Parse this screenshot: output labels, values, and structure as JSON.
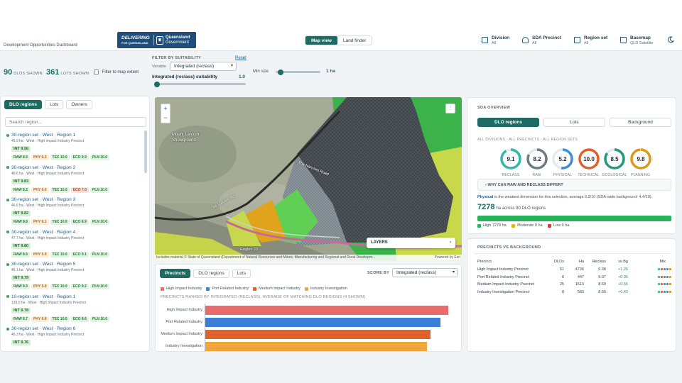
{
  "app": {
    "title": "Development Opportunities Dashboard"
  },
  "logo": {
    "line1a": "DELIVERING",
    "line1b": "FOR QUEENSLAND",
    "line2a": "Queensland",
    "line2b": "Government"
  },
  "view_toggle": {
    "map": "Map view",
    "land": "Land finder"
  },
  "nav": [
    {
      "label": "Division",
      "value": "All"
    },
    {
      "label": "SDA Precinct",
      "value": "All"
    },
    {
      "label": "Region set",
      "value": "All"
    },
    {
      "label": "Basemap",
      "value": "QLD Satellite"
    }
  ],
  "stats": {
    "dlos": "90",
    "dlos_label": "DLOS SHOWN",
    "lots": "361",
    "lots_label": "LOTS SHOWN",
    "filter_label": "Filter to map extent"
  },
  "filter": {
    "heading": "FILTER BY SUITABILITY",
    "reset": "Reset",
    "variable_label": "Variable",
    "variable_value": "Integrated (reclass)",
    "slider_label": "Integrated (reclass) suitability",
    "slider_value": "1.0",
    "minsize_label": "Min size",
    "minsize_value": "1 ha",
    "minsize_fraction": 0.05,
    "suitability_fraction": 0.0
  },
  "left": {
    "tabs": [
      "DLO regions",
      "Lots",
      "Owners"
    ],
    "search_placeholder": "Search region...",
    "regions": [
      {
        "name": "30-region set · West · Region 1",
        "sub": "45.9 ha · West · High Impact Industry Precinct",
        "int": "INT 9.56",
        "chips": [
          [
            "RAW 8.5",
            "g"
          ],
          [
            "PHY 6.3",
            "o"
          ],
          [
            "TEC 10.0",
            "g"
          ],
          [
            "ECO 9.9",
            "g"
          ],
          [
            "PLN 10.0",
            "g"
          ]
        ]
      },
      {
        "name": "30-region set · West · Region 2",
        "sub": "48.6 ha · West · High Impact Industry Precinct",
        "int": "INT 9.83",
        "chips": [
          [
            "RAW 8.2",
            "g"
          ],
          [
            "PHY 6.0",
            "o"
          ],
          [
            "TEC 10.0",
            "g"
          ],
          [
            "ECO 7.0",
            "r"
          ],
          [
            "PLN 10.0",
            "g"
          ]
        ]
      },
      {
        "name": "30-region set · West · Region 3",
        "sub": "46.6 ha · West · High Impact Industry Precinct",
        "int": "INT 9.82",
        "chips": [
          [
            "RAW 8.6",
            "g"
          ],
          [
            "PHY 6.1",
            "o"
          ],
          [
            "TEC 10.0",
            "g"
          ],
          [
            "ECO 8.9",
            "g"
          ],
          [
            "PLN 10.0",
            "g"
          ]
        ]
      },
      {
        "name": "30-region set · West · Region 4",
        "sub": "47.7 ha · West · High Impact Industry Precinct",
        "int": "INT 9.80",
        "chips": [
          [
            "RAW 8.6",
            "g"
          ],
          [
            "PHY 5.9",
            "o"
          ],
          [
            "TEC 10.0",
            "g"
          ],
          [
            "ECO 9.1",
            "g"
          ],
          [
            "PLN 10.0",
            "g"
          ]
        ]
      },
      {
        "name": "30-region set · West · Region 5",
        "sub": "46.1 ha · West · High Impact Industry Precinct",
        "int": "INT 9.79",
        "chips": [
          [
            "RAW 8.5",
            "g"
          ],
          [
            "PHY 5.9",
            "o"
          ],
          [
            "TEC 10.0",
            "g"
          ],
          [
            "ECO 9.2",
            "g"
          ],
          [
            "PLN 10.0",
            "g"
          ]
        ]
      },
      {
        "name": "10-region set · West · Region 1",
        "sub": "139.0 ha · West · High Impact Industry Precinct",
        "int": "INT 9.78",
        "chips": [
          [
            "RAW 8.7",
            "g"
          ],
          [
            "PHY 6.8",
            "o"
          ],
          [
            "TEC 10.0",
            "g"
          ],
          [
            "ECO 8.6",
            "g"
          ],
          [
            "PLN 10.0",
            "g"
          ]
        ]
      },
      {
        "name": "30-region set · West · Region 6",
        "sub": "46.3 ha · West · High Impact Industry Precinct",
        "int": "INT 9.76",
        "chips": []
      }
    ]
  },
  "map": {
    "labels": [
      "Mount Larcom",
      "Showground",
      "The Narrows Road",
      "Mt Larcom Rd",
      "Bruce Hwy",
      "Region 23"
    ],
    "attribution": "Includes material © State of Queensland (Department of Natural Resources and Mines, Manufacturing and Regional and Rural Developm...",
    "powered": "Powered by Esri",
    "layers": "LAYERS",
    "zoom_in": "+",
    "zoom_out": "−"
  },
  "chart_panel": {
    "tabs": [
      "Precincts",
      "DLO regions",
      "Lots"
    ],
    "score_by_label": "SCORE BY",
    "score_by_value": "Integrated (reclass)",
    "legend": [
      {
        "name": "High Impact Industry",
        "color": "#e96b6b"
      },
      {
        "name": "Port Related Industry",
        "color": "#3a7fd5"
      },
      {
        "name": "Medium Impact Industry",
        "color": "#e0612a"
      },
      {
        "name": "Industry Investigation",
        "color": "#f0a63a"
      }
    ],
    "subtitle": "PRECINCTS RANKED BY INTEGRATED (RECLASS), AVERAGE OF MATCHING DLO REGIONS (4 SHOWN)"
  },
  "chart_data": {
    "type": "bar",
    "orientation": "horizontal",
    "categories": [
      "High Impact Industry",
      "Port Related Industry",
      "Medium Impact Industry",
      "Industry Investigation"
    ],
    "values": [
      9.38,
      9.07,
      8.69,
      8.55
    ],
    "colors": [
      "#e96b6b",
      "#3a7fd5",
      "#e0612a",
      "#f0a63a"
    ],
    "xlim": [
      0,
      10
    ]
  },
  "sda": {
    "heading": "SDA OVERVIEW",
    "tabs": [
      "DLO regions",
      "Lots",
      "Background"
    ],
    "filter_text": "ALL DIVISIONS · ALL PRECINCTS · ALL REGION SETS",
    "rings": [
      {
        "value": "9.1",
        "label": "RECLASS",
        "color": "#2fb8b0",
        "fraction": 0.91
      },
      {
        "value": "8.2",
        "label": "RAW",
        "color": "#6b7c85",
        "fraction": 0.82
      },
      {
        "value": "5.2",
        "label": "PHYSICAL",
        "color": "#3a8ed6",
        "fraction": 0.52
      },
      {
        "value": "10.0",
        "label": "TECHNICAL",
        "color": "#e0612a",
        "fraction": 1.0
      },
      {
        "value": "8.5",
        "label": "ECOLOGICAL",
        "color": "#1f9a7a",
        "fraction": 0.85
      },
      {
        "value": "9.8",
        "label": "PLANNING",
        "color": "#d99a1a",
        "fraction": 0.98
      }
    ],
    "why_label": "WHY CAN RAW AND RECLASS DIFFER?",
    "weak_dim": "Physical",
    "weak_text": " is the weakest dimension for this selection, average 5.2/10 (SDA-wide background: 4.4/10).",
    "ha_value": "7278",
    "ha_text": "ha across 90 DLO regions",
    "bar_high_fraction": 1.0,
    "bar_legend": [
      "High 7278 ha",
      "Moderate 0 ha",
      "Low 0 ha"
    ]
  },
  "precincts": {
    "heading": "PRECINCTS VS BACKGROUND",
    "headers": [
      "Precinct",
      "DLOs",
      "Ha",
      "Reclass",
      "vs Bg",
      "Mix"
    ],
    "rows": [
      [
        "High Impact Industry Precinct",
        "51",
        "4736",
        "9.38",
        "+1.26"
      ],
      [
        "Port Related Industry Precinct",
        "6",
        "447",
        "9.07",
        "+0.95"
      ],
      [
        "Medium Impact Industry Precinct",
        "25",
        "1513",
        "8.69",
        "+0.56"
      ],
      [
        "Industry Investigation Precinct",
        "8",
        "583",
        "8.55",
        "+0.43"
      ]
    ]
  }
}
